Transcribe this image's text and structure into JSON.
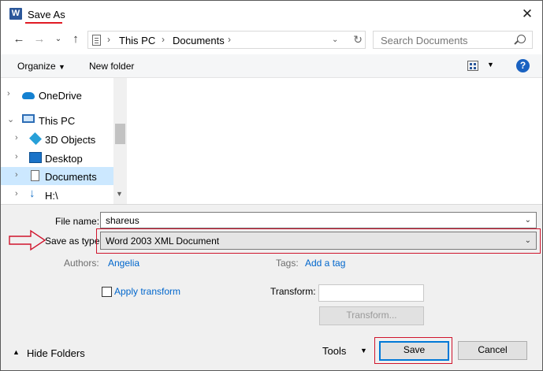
{
  "window": {
    "title": "Save As",
    "app_icon": "W"
  },
  "address": {
    "path": [
      "This PC",
      "Documents"
    ],
    "search_placeholder": "Search Documents"
  },
  "toolbar": {
    "organize": "Organize",
    "new_folder": "New folder",
    "help": "?"
  },
  "tree": {
    "items": [
      {
        "label": "OneDrive"
      },
      {
        "label": "This PC"
      },
      {
        "label": "3D Objects"
      },
      {
        "label": "Desktop"
      },
      {
        "label": "Documents"
      },
      {
        "label": "H:\\"
      }
    ]
  },
  "form": {
    "file_name_label": "File name:",
    "file_name_value": "shareus",
    "save_type_label": "Save as type:",
    "save_type_value": "Word 2003 XML Document",
    "authors_label": "Authors:",
    "authors_value": "Angelia",
    "tags_label": "Tags:",
    "tags_value": "Add a tag",
    "apply_transform": "Apply transform",
    "transform_label": "Transform:",
    "transform_button": "Transform..."
  },
  "footer": {
    "hide_folders": "Hide Folders",
    "tools": "Tools",
    "save": "Save",
    "cancel": "Cancel"
  },
  "colors": {
    "annotation": "#d0142c",
    "accent": "#0078d7",
    "selection": "#cce8ff"
  }
}
